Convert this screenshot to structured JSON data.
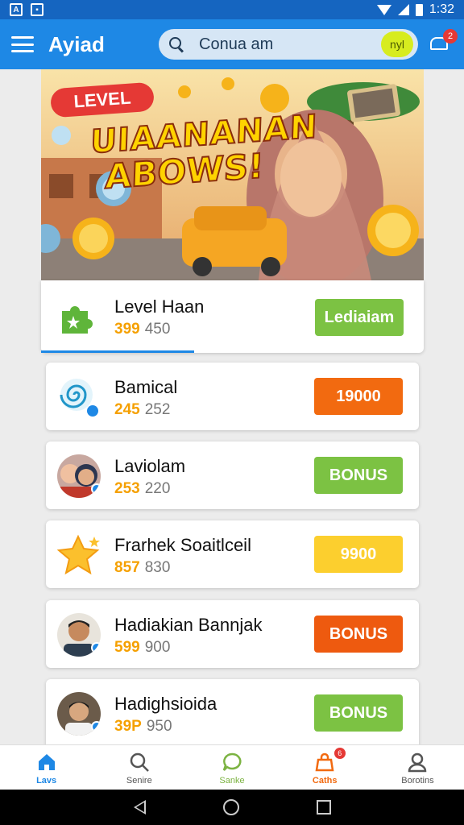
{
  "status": {
    "time": "1:32"
  },
  "appbar": {
    "title": "Ayiad",
    "search_text": "Conua am",
    "search_badge": "nyl",
    "notification_count": "2"
  },
  "banner": {
    "badge": "LEVEL",
    "headline_line1": "UIAANANAN",
    "headline_line2": "ABOWS!"
  },
  "cards": [
    {
      "title": "Level Haan",
      "num_a": "399",
      "num_b": "450",
      "button": "Lediaiam",
      "icon": "puzzle-icon",
      "button_color": "#7cc243"
    },
    {
      "title": "Bamical",
      "num_a": "245",
      "num_b": "252",
      "button": "19000",
      "icon": "spiral-lollipop-icon",
      "button_color": "#f26a10"
    },
    {
      "title": "Laviolam",
      "num_a": "253",
      "num_b": "220",
      "button": "BONUS",
      "icon": "two-users-avatar",
      "button_color": "#7cc243"
    },
    {
      "title": "Frarhek Soaitlceil",
      "num_a": "857",
      "num_b": "830",
      "button": "9900",
      "icon": "star-icon",
      "button_color": "#fccf2e"
    },
    {
      "title": "Hadiakian Bannjak",
      "num_a": "599",
      "num_b": "900",
      "button": "BONUS",
      "icon": "man-avatar",
      "button_color": "#ee5a0f"
    },
    {
      "title": "Hadighsioida",
      "num_a": "39P",
      "num_b": "950",
      "button": "BONUS",
      "icon": "person-avatar",
      "button_color": "#7cc243"
    }
  ],
  "bottom_nav": [
    {
      "label": "Lavs",
      "icon": "home-icon",
      "color": "#1e88e5"
    },
    {
      "label": "Senire",
      "icon": "search-icon",
      "color": "#555555"
    },
    {
      "label": "Sanke",
      "icon": "chat-icon",
      "color": "#7cb342"
    },
    {
      "label": "Caths",
      "icon": "bag-icon",
      "color": "#f26a10",
      "badge": "6"
    },
    {
      "label": "Borotins",
      "icon": "profile-icon",
      "color": "#555555"
    }
  ]
}
